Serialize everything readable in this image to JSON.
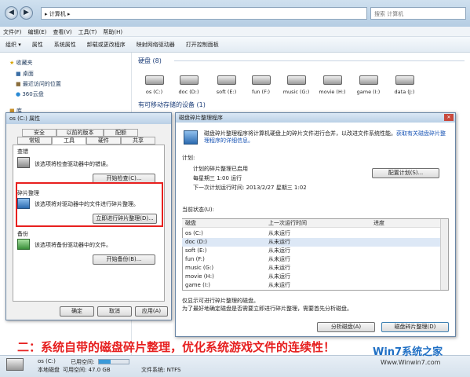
{
  "window": {
    "breadcrumb": "▸ 计算机 ▸",
    "search_placeholder": "搜索 计算机"
  },
  "menu": [
    "文件(F)",
    "编辑(E)",
    "查看(V)",
    "工具(T)",
    "帮助(H)"
  ],
  "toolbar": [
    "组织 ▾",
    "属性",
    "系统属性",
    "卸载或更改程序",
    "映射网络驱动器",
    "打开控制面板"
  ],
  "nav": [
    {
      "label": "收藏夹"
    },
    {
      "label": "桌面"
    },
    {
      "label": "最近访问的位置"
    },
    {
      "label": "360云盘"
    },
    {
      "label": "库"
    }
  ],
  "group_disks": "硬盘 (8)",
  "group_removable": "有可移动存储的设备 (1)",
  "drives": [
    "os (C:)",
    "doc (D:)",
    "soft (E:)",
    "fun (F:)",
    "music (G:)",
    "movie (H:)",
    "game (I:)",
    "data (J:)"
  ],
  "status": {
    "drive": "os (C:)",
    "type": "本地磁盘",
    "used_label": "已用空间:",
    "free_label": "可用空间: 47.0 GB",
    "fs_label": "文件系统: NTFS"
  },
  "props": {
    "title": "os (C:) 属性",
    "tabs_top": [
      "安全",
      "以前的版本",
      "配额"
    ],
    "tabs_bottom": [
      "常规",
      "工具",
      "硬件",
      "共享"
    ],
    "check_title": "查错",
    "check_desc": "该选项将检查驱动器中的错误。",
    "check_btn": "开始检查(C)...",
    "defrag_title": "碎片整理",
    "defrag_desc": "该选项将对驱动器中的文件进行碎片整理。",
    "defrag_btn": "立即进行碎片整理(D)...",
    "backup_title": "备份",
    "backup_desc": "该选项将备份驱动器中的文件。",
    "backup_btn": "开始备份(B)...",
    "ok": "确定",
    "cancel": "取消",
    "apply": "应用(A)"
  },
  "defrag": {
    "title": "磁盘碎片整理程序",
    "intro": "磁盘碎片整理程序将计算机硬盘上的碎片文件进行合并，以改进文件系统性能。",
    "intro_link": "获取有关磁盘碎片整理程序的详细信息。",
    "schedule_label": "计划:",
    "schedule_on": "计划的碎片整理已启用",
    "schedule_run": "每星期三 1:00 运行",
    "schedule_next": "下一次计划运行时间: 2013/2/27 星期三 1:02",
    "config_btn": "配置计划(S)...",
    "current_label": "当前状态(U):",
    "col_disk": "磁盘",
    "col_last": "上一次运行时间",
    "col_progress": "进度",
    "disks": [
      {
        "name": "os (C:)",
        "last": "从未运行"
      },
      {
        "name": "doc (D:)",
        "last": "从未运行"
      },
      {
        "name": "soft (E:)",
        "last": "从未运行"
      },
      {
        "name": "fun (F:)",
        "last": "从未运行"
      },
      {
        "name": "music (G:)",
        "last": "从未运行"
      },
      {
        "name": "movie (H:)",
        "last": "从未运行"
      },
      {
        "name": "game (I:)",
        "last": "从未运行"
      }
    ],
    "note1": "仅显示可进行碎片整理的磁盘。",
    "note2": "为了最好地确定磁盘是否需要立即进行碎片整理，需要首先分析磁盘。",
    "analyze_btn": "分析磁盘(A)",
    "defrag_btn": "磁盘碎片整理(D)"
  },
  "caption": "二：系统自带的磁盘碎片整理，优化系统游戏文件的连续性！",
  "logo": {
    "brand": "Win7系统之家",
    "url": "Www.Winwin7.com"
  },
  "colors": {
    "caption": "#e62020",
    "highlight_box": "#e8201e"
  }
}
